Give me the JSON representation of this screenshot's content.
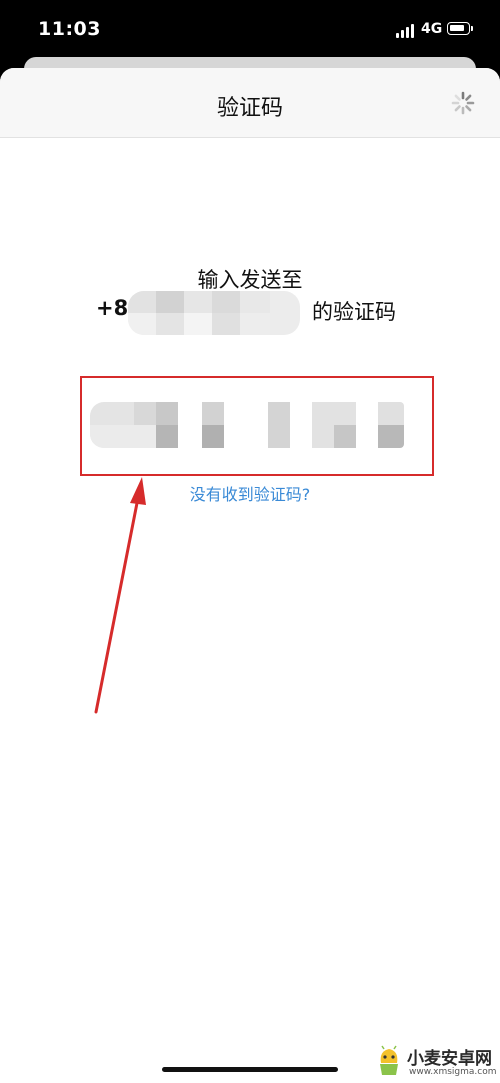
{
  "status_bar": {
    "time": "11:03",
    "network": "4G"
  },
  "nav": {
    "title": "验证码",
    "spinner_icon": "loading-spinner-icon"
  },
  "prompt": {
    "line1": "输入发送至",
    "phone_prefix": "+8",
    "phone_suffix": "的验证码"
  },
  "code_input": {
    "value": ""
  },
  "resend_link": "没有收到验证码?",
  "watermark": {
    "title": "小麦安卓网",
    "url": "www.xmsigma.com"
  },
  "colors": {
    "link": "#3a8ad6",
    "annotation": "#d62b2b",
    "navbar": "#f7f7f7"
  }
}
